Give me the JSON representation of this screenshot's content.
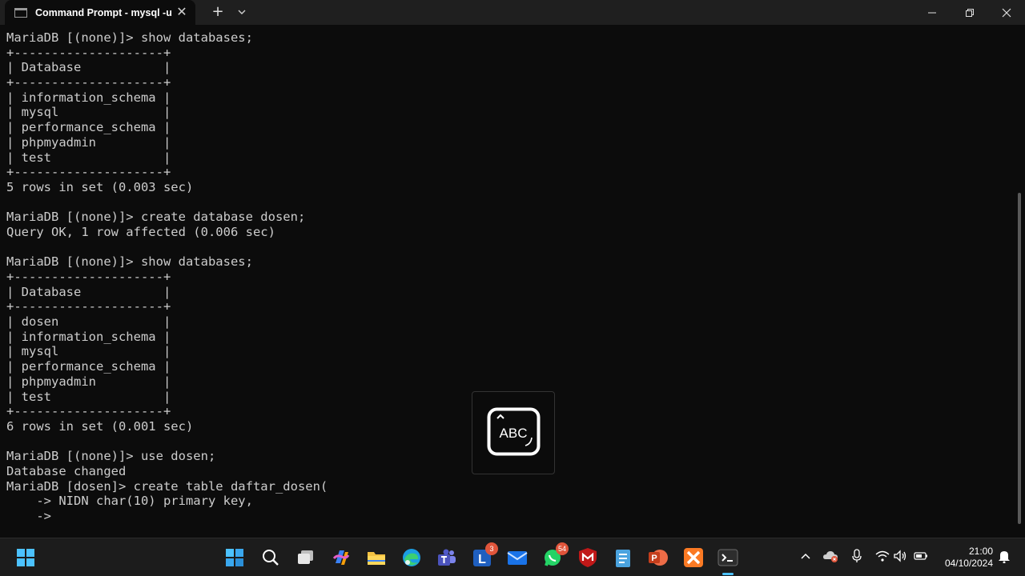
{
  "window": {
    "tab_title": "Command Prompt - mysql  -u",
    "new_tab_label": "+",
    "close_tab_label": "✕"
  },
  "terminal": {
    "lines": [
      "MariaDB [(none)]> show databases;",
      "+--------------------+",
      "| Database           |",
      "+--------------------+",
      "| information_schema |",
      "| mysql              |",
      "| performance_schema |",
      "| phpmyadmin         |",
      "| test               |",
      "+--------------------+",
      "5 rows in set (0.003 sec)",
      "",
      "MariaDB [(none)]> create database dosen;",
      "Query OK, 1 row affected (0.006 sec)",
      "",
      "MariaDB [(none)]> show databases;",
      "+--------------------+",
      "| Database           |",
      "+--------------------+",
      "| dosen              |",
      "| information_schema |",
      "| mysql              |",
      "| performance_schema |",
      "| phpmyadmin         |",
      "| test               |",
      "+--------------------+",
      "6 rows in set (0.001 sec)",
      "",
      "MariaDB [(none)]> use dosen;",
      "Database changed",
      "MariaDB [dosen]> create table daftar_dosen(",
      "    -> NIDN char(10) primary key,",
      "    ->"
    ]
  },
  "overlay": {
    "label": "ABC"
  },
  "taskbar": {
    "items": [
      {
        "name": "start",
        "icon": "windows-logo-icon"
      },
      {
        "name": "search",
        "icon": "search-icon"
      },
      {
        "name": "task-view",
        "icon": "task-view-icon"
      },
      {
        "name": "copilot",
        "icon": "copilot-icon"
      },
      {
        "name": "file-explorer",
        "icon": "folder-icon"
      },
      {
        "name": "edge",
        "icon": "edge-icon"
      },
      {
        "name": "teams",
        "icon": "teams-icon"
      },
      {
        "name": "l-app",
        "icon": "l-app-icon",
        "badge": "3"
      },
      {
        "name": "mail",
        "icon": "mail-icon"
      },
      {
        "name": "whatsapp",
        "icon": "whatsapp-icon",
        "badge": "54"
      },
      {
        "name": "mcafee",
        "icon": "mcafee-icon"
      },
      {
        "name": "notepad",
        "icon": "notepad-icon"
      },
      {
        "name": "powerpoint",
        "icon": "powerpoint-icon"
      },
      {
        "name": "xampp",
        "icon": "xampp-icon"
      },
      {
        "name": "terminal",
        "icon": "terminal-icon"
      }
    ],
    "clock": {
      "time": "21:00",
      "date": "04/10/2024"
    }
  },
  "colors": {
    "terminal_bg": "#0c0c0c",
    "terminal_text": "#cccccc",
    "titlebar_bg": "#1f1f1f",
    "taskbar_bg": "#1c1c1c",
    "accent": "#4cc2ff",
    "badge": "#e0553b"
  }
}
